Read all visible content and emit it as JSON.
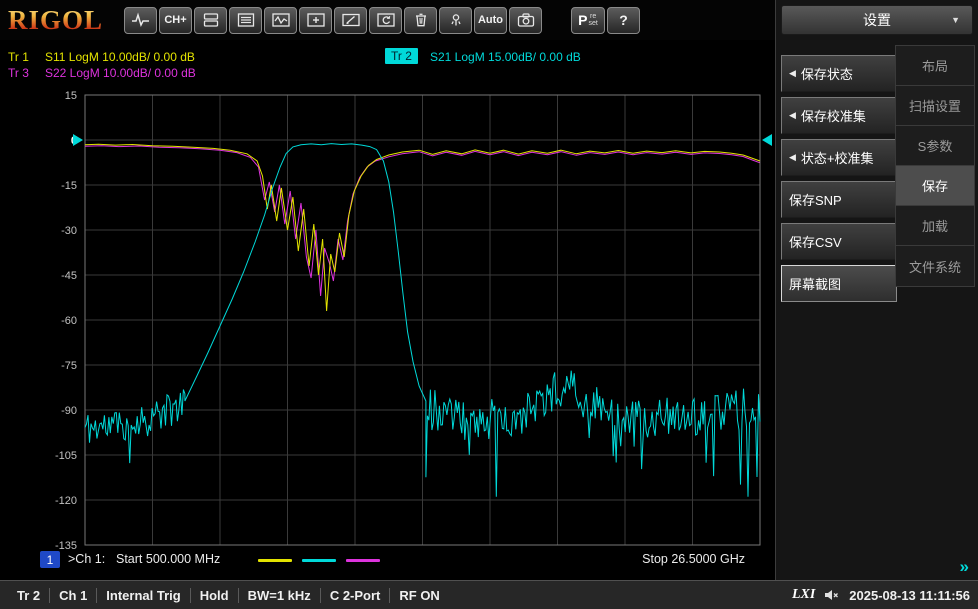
{
  "toolbar": {
    "logo": "RIGOL",
    "ch_plus_label": "CH+",
    "auto_label": "Auto",
    "preset_p": "P",
    "preset_re": "re",
    "preset_set": "set",
    "help_label": "?"
  },
  "sidebar": {
    "title": "设置",
    "dropdown_icon": "▼",
    "submenu_arrow": "◀",
    "collapse_glyph": "»",
    "menu_items": [
      {
        "label": "保存状态",
        "submenu": true,
        "selected": false
      },
      {
        "label": "保存校准集",
        "submenu": true,
        "selected": false
      },
      {
        "label": "状态+校准集",
        "submenu": true,
        "selected": false
      },
      {
        "label": "保存SNP",
        "submenu": false,
        "selected": false
      },
      {
        "label": "保存CSV",
        "submenu": false,
        "selected": false
      },
      {
        "label": "屏幕截图",
        "submenu": false,
        "selected": true
      }
    ],
    "tabs": [
      {
        "label": "布局",
        "active": false
      },
      {
        "label": "扫描设置",
        "active": false
      },
      {
        "label": "S参数",
        "active": false
      },
      {
        "label": "保存",
        "active": true
      },
      {
        "label": "加载",
        "active": false
      },
      {
        "label": "文件系统",
        "active": false
      }
    ]
  },
  "trace_header": {
    "tr1_id": "Tr 1",
    "tr1_text": "S11 LogM 10.00dB/ 0.00 dB",
    "tr2_id": "Tr 2",
    "tr2_text": "S21 LogM 15.00dB/ 0.00 dB",
    "tr3_id": "Tr 3",
    "tr3_text": "S22 LogM 10.00dB/ 0.00 dB"
  },
  "legend": {
    "channel_badge": "1",
    "ch_label": ">Ch 1:",
    "start_text": "Start 500.000 MHz",
    "stop_text": "Stop 26.5000 GHz"
  },
  "status_bar": {
    "items": [
      "Tr 2",
      "Ch 1",
      "Internal Trig",
      "Hold",
      "BW=1 kHz",
      "C 2-Port",
      "RF ON"
    ],
    "lxi": "LXI",
    "timestamp": "2025-08-13 11:11:56"
  },
  "chart_data": {
    "type": "line",
    "title": "VNA S-parameter measurement",
    "y_axis": {
      "max": 15,
      "min": -135,
      "step": 15,
      "unit": "dB"
    },
    "x_axis": {
      "divisions": 10,
      "start_label": "Start 500.000 MHz",
      "stop_label": "Stop 26.5000 GHz"
    },
    "ref_level_db": 0,
    "grid": true,
    "traces": [
      {
        "name": "S22",
        "color": "#dd33dd",
        "segments": [
          {
            "t": "pts",
            "p": [
              [
                0.0,
                -2.1
              ],
              [
                0.025,
                -1.9
              ],
              [
                0.05,
                -2.2
              ],
              [
                0.08,
                -2.0
              ],
              [
                0.11,
                -2.4
              ],
              [
                0.14,
                -2.6
              ],
              [
                0.17,
                -2.9
              ],
              [
                0.2,
                -3.4
              ],
              [
                0.225,
                -4.2
              ],
              [
                0.245,
                -5.8
              ],
              [
                0.257,
                -9.0
              ],
              [
                0.266,
                -20
              ],
              [
                0.273,
                -14
              ],
              [
                0.281,
                -24
              ],
              [
                0.288,
                -15
              ],
              [
                0.296,
                -28
              ],
              [
                0.304,
                -17
              ],
              [
                0.312,
                -33
              ],
              [
                0.32,
                -21
              ],
              [
                0.328,
                -39
              ],
              [
                0.335,
                -46
              ],
              [
                0.342,
                -30
              ],
              [
                0.349,
                -52
              ],
              [
                0.355,
                -36
              ],
              [
                0.362,
                -41
              ],
              [
                0.368,
                -47
              ],
              [
                0.375,
                -33
              ],
              [
                0.382,
                -40
              ],
              [
                0.389,
                -27
              ],
              [
                0.397,
                -18
              ],
              [
                0.407,
                -12.5
              ],
              [
                0.418,
                -9
              ],
              [
                0.43,
                -7
              ],
              [
                0.45,
                -5.6
              ],
              [
                0.47,
                -4.6
              ],
              [
                0.495,
                -3.9
              ],
              [
                0.515,
                -5.3
              ],
              [
                0.535,
                -4.1
              ],
              [
                0.558,
                -5.1
              ],
              [
                0.578,
                -3.8
              ],
              [
                0.6,
                -4.9
              ],
              [
                0.62,
                -3.9
              ],
              [
                0.642,
                -5.2
              ],
              [
                0.662,
                -4.1
              ],
              [
                0.685,
                -4.9
              ],
              [
                0.705,
                -3.9
              ],
              [
                0.728,
                -5.1
              ],
              [
                0.748,
                -4.2
              ],
              [
                0.77,
                -4.8
              ],
              [
                0.79,
                -4.0
              ],
              [
                0.812,
                -4.9
              ],
              [
                0.832,
                -4.2
              ],
              [
                0.855,
                -4.7
              ],
              [
                0.875,
                -4.1
              ],
              [
                0.898,
                -4.8
              ],
              [
                0.918,
                -4.3
              ],
              [
                0.94,
                -4.5
              ],
              [
                0.958,
                -4.9
              ],
              [
                0.975,
                -5.5
              ],
              [
                0.99,
                -6.8
              ],
              [
                1.0,
                -7.6
              ]
            ]
          }
        ]
      },
      {
        "name": "S11",
        "color": "#e3e300",
        "segments": [
          {
            "t": "pts",
            "p": [
              [
                0.0,
                -1.6
              ],
              [
                0.02,
                -1.4
              ],
              [
                0.045,
                -1.7
              ],
              [
                0.07,
                -1.5
              ],
              [
                0.1,
                -1.9
              ],
              [
                0.13,
                -2.1
              ],
              [
                0.16,
                -2.4
              ],
              [
                0.19,
                -2.8
              ],
              [
                0.215,
                -3.4
              ],
              [
                0.24,
                -4.6
              ],
              [
                0.255,
                -7.0
              ],
              [
                0.263,
                -12
              ],
              [
                0.27,
                -23
              ],
              [
                0.276,
                -15
              ],
              [
                0.284,
                -27
              ],
              [
                0.291,
                -16
              ],
              [
                0.3,
                -30
              ],
              [
                0.308,
                -19
              ],
              [
                0.316,
                -37
              ],
              [
                0.324,
                -23
              ],
              [
                0.332,
                -42
              ],
              [
                0.339,
                -28
              ],
              [
                0.346,
                -45
              ],
              [
                0.352,
                -33
              ],
              [
                0.358,
                -57
              ],
              [
                0.364,
                -38
              ],
              [
                0.37,
                -44
              ],
              [
                0.377,
                -31
              ],
              [
                0.384,
                -39
              ],
              [
                0.391,
                -25
              ],
              [
                0.399,
                -17
              ],
              [
                0.409,
                -12
              ],
              [
                0.42,
                -8.5
              ],
              [
                0.432,
                -6.5
              ],
              [
                0.45,
                -5.0
              ],
              [
                0.47,
                -4.0
              ],
              [
                0.495,
                -3.4
              ],
              [
                0.515,
                -4.8
              ],
              [
                0.535,
                -3.6
              ],
              [
                0.558,
                -4.6
              ],
              [
                0.578,
                -3.3
              ],
              [
                0.6,
                -4.4
              ],
              [
                0.62,
                -3.4
              ],
              [
                0.642,
                -4.7
              ],
              [
                0.662,
                -3.6
              ],
              [
                0.685,
                -4.4
              ],
              [
                0.705,
                -3.4
              ],
              [
                0.728,
                -4.6
              ],
              [
                0.748,
                -3.7
              ],
              [
                0.77,
                -4.3
              ],
              [
                0.79,
                -3.5
              ],
              [
                0.812,
                -4.4
              ],
              [
                0.832,
                -3.7
              ],
              [
                0.855,
                -4.2
              ],
              [
                0.875,
                -3.6
              ],
              [
                0.898,
                -4.3
              ],
              [
                0.918,
                -3.8
              ],
              [
                0.94,
                -4.0
              ],
              [
                0.958,
                -4.4
              ],
              [
                0.975,
                -5.0
              ],
              [
                0.99,
                -6.2
              ],
              [
                1.0,
                -7.0
              ]
            ]
          }
        ]
      },
      {
        "name": "S21",
        "color": "#00d9d9",
        "segments": [
          {
            "t": "noise",
            "f0": 0.0,
            "f1": 0.148,
            "amp": 6,
            "spike_amp": 16,
            "spike_p": 0.05,
            "seed": 11,
            "base": [
              [
                0.0,
                -96
              ],
              [
                0.05,
                -95
              ],
              [
                0.09,
                -93
              ],
              [
                0.13,
                -90
              ],
              [
                0.148,
                -87
              ]
            ]
          },
          {
            "t": "pts",
            "p": [
              [
                0.148,
                -87
              ],
              [
                0.165,
                -79
              ],
              [
                0.182,
                -71
              ],
              [
                0.2,
                -62
              ],
              [
                0.218,
                -53
              ],
              [
                0.235,
                -44
              ],
              [
                0.252,
                -34
              ],
              [
                0.266,
                -25
              ],
              [
                0.278,
                -16
              ],
              [
                0.289,
                -9
              ],
              [
                0.298,
                -4.5
              ],
              [
                0.308,
                -2.3
              ],
              [
                0.32,
                -1.6
              ],
              [
                0.335,
                -1.3
              ],
              [
                0.35,
                -1.6
              ],
              [
                0.365,
                -1.2
              ],
              [
                0.38,
                -1.5
              ],
              [
                0.395,
                -1.3
              ],
              [
                0.41,
                -1.7
              ],
              [
                0.422,
                -2.2
              ],
              [
                0.432,
                -3.2
              ],
              [
                0.442,
                -7
              ],
              [
                0.45,
                -14
              ],
              [
                0.457,
                -24
              ],
              [
                0.464,
                -37
              ],
              [
                0.471,
                -51
              ],
              [
                0.478,
                -64
              ],
              [
                0.486,
                -74
              ],
              [
                0.495,
                -82
              ],
              [
                0.505,
                -87
              ]
            ]
          },
          {
            "t": "noise",
            "f0": 0.505,
            "f1": 1.0,
            "amp": 7,
            "spike_amp": 28,
            "spike_p": 0.07,
            "seed": 23,
            "base": [
              [
                0.505,
                -89
              ],
              [
                0.55,
                -93
              ],
              [
                0.6,
                -93
              ],
              [
                0.65,
                -91
              ],
              [
                0.69,
                -85
              ],
              [
                0.715,
                -80
              ],
              [
                0.74,
                -86
              ],
              [
                0.78,
                -92
              ],
              [
                0.84,
                -93
              ],
              [
                0.9,
                -92
              ],
              [
                0.95,
                -91
              ],
              [
                1.0,
                -88
              ]
            ]
          }
        ]
      }
    ]
  }
}
